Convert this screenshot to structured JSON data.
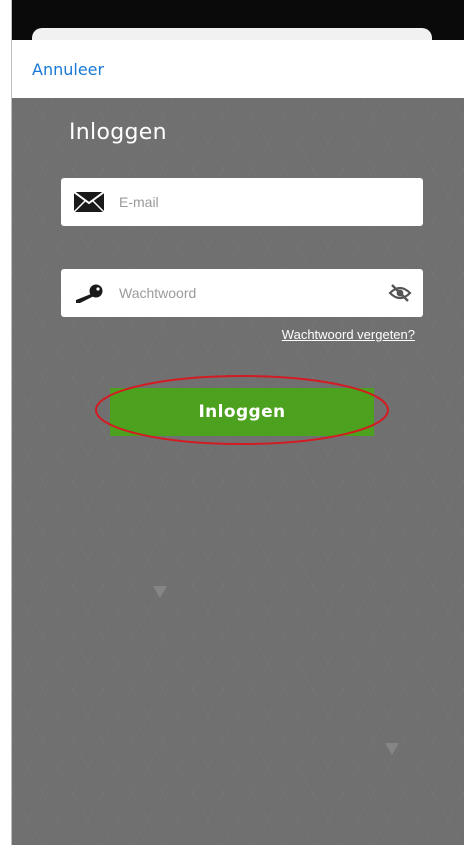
{
  "nav": {
    "cancel_label": "Annuleer"
  },
  "login": {
    "title": "Inloggen",
    "email_placeholder": "E-mail",
    "password_placeholder": "Wachtwoord",
    "forgot_password": "Wachtwoord vergeten?",
    "submit_label": "Inloggen"
  },
  "icons": {
    "email": "envelope-icon",
    "password": "key-icon",
    "visibility": "eye-slash-icon"
  },
  "colors": {
    "link": "#1878d6",
    "background": "#707070",
    "button": "#4ca11f",
    "highlight": "#d41b22"
  }
}
